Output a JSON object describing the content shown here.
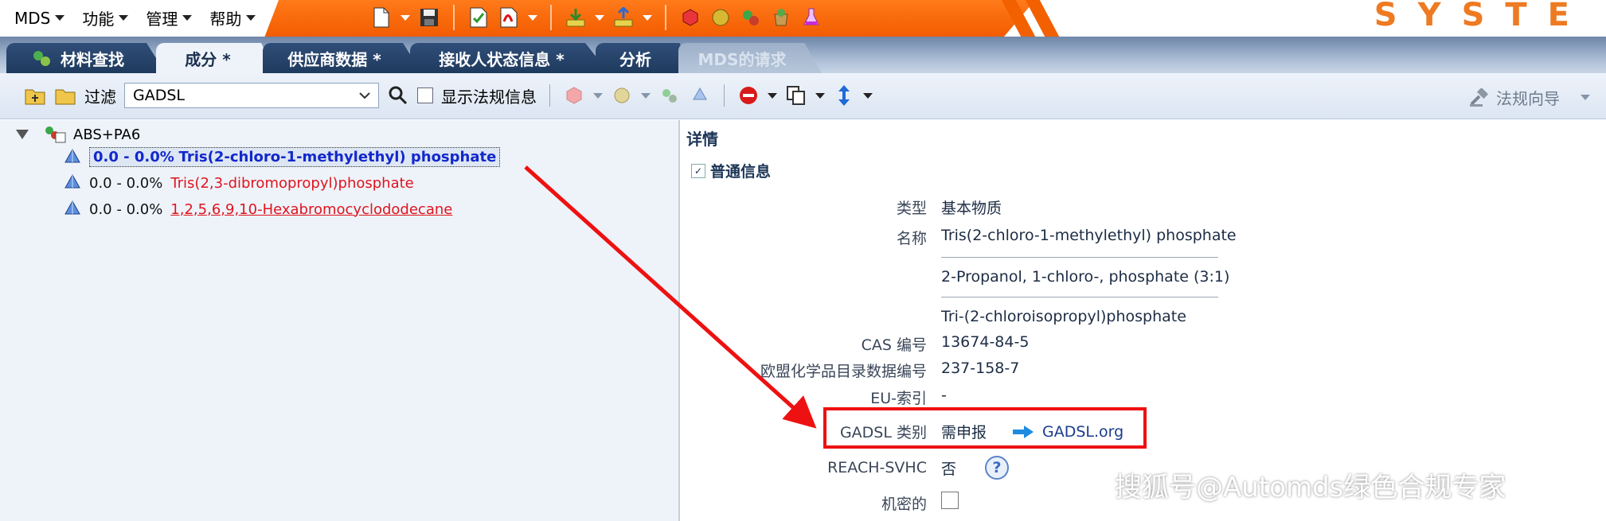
{
  "brand": "SYSTE",
  "menus": [
    {
      "label": "MDS"
    },
    {
      "label": "功能"
    },
    {
      "label": "管理"
    },
    {
      "label": "帮助"
    }
  ],
  "tabs": [
    {
      "label": "材料查找"
    },
    {
      "label": "成分 *"
    },
    {
      "label": "供应商数据 *"
    },
    {
      "label": "接收人状态信息 *"
    },
    {
      "label": "分析"
    },
    {
      "label": "MDS的请求"
    }
  ],
  "toolbar": {
    "filter_label": "过滤",
    "filter_value": "GADSL",
    "show_reg_label": "显示法规信息",
    "wizard_label": "法规向导"
  },
  "tree": {
    "root": "ABS+PA6",
    "items": [
      {
        "pct": "0.0 - 0.0%",
        "name": "Tris(2-chloro-1-methylethyl) phosphate"
      },
      {
        "pct": "0.0 - 0.0%",
        "name": "Tris(2,3-dibromopropyl)phosphate"
      },
      {
        "pct": "0.0 - 0.0%",
        "name": "1,2,5,6,9,10-Hexabromocyclododecane"
      }
    ]
  },
  "detail": {
    "title": "详情",
    "section": "普通信息",
    "type_label": "类型",
    "type_value": "基本物质",
    "name_label": "名称",
    "names": [
      "Tris(2-chloro-1-methylethyl) phosphate",
      "2-Propanol, 1-chloro-, phosphate (3:1)",
      "Tri-(2-chloroisopropyl)phosphate"
    ],
    "cas_label": "CAS 编号",
    "cas_value": "13674-84-5",
    "ec_label": "欧盟化学品目录数据编号",
    "ec_value": "237-158-7",
    "eu_label": "EU-索引",
    "eu_value": "-",
    "gadsl_label": "GADSL 类别",
    "gadsl_value": "需申报",
    "gadsl_link": "GADSL.org",
    "reach_label": "REACH-SVHC",
    "reach_value": "否",
    "conf_label": "机密的"
  },
  "watermark": "搜狐号@Automds绿色合规专家",
  "colors": {
    "orange": "#f25c00",
    "navy": "#1f3a5e",
    "link_blue": "#1228cc",
    "red": "#e0141e",
    "highlight": "#ee1111"
  }
}
